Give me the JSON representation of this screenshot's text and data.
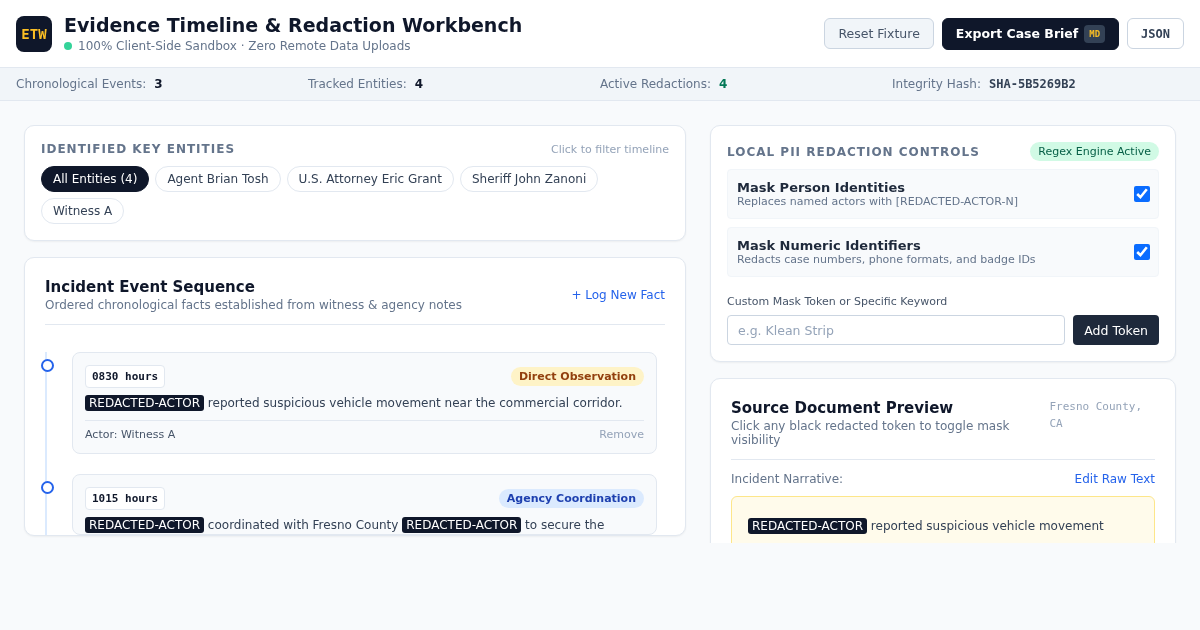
{
  "header": {
    "logo": "ETW",
    "title": "Evidence Timeline & Redaction Workbench",
    "subtitle": "100% Client-Side Sandbox · Zero Remote Data Uploads",
    "buttons": [
      {
        "kind": "secondary",
        "label": "Reset Fixture"
      },
      {
        "kind": "primary",
        "label": "Export Case Brief",
        "badge": "MD"
      },
      {
        "kind": "code",
        "label": "JSON"
      }
    ]
  },
  "stats": [
    {
      "label": "Chronological Events:",
      "value": "3",
      "kind": "count"
    },
    {
      "label": "Tracked Entities:",
      "value": "4",
      "kind": "count"
    },
    {
      "label": "Active Redactions:",
      "value": "4",
      "kind": "positive"
    },
    {
      "label": "Integrity Hash:",
      "value": "SHA-5B5269B2",
      "kind": "hash"
    }
  ],
  "entities": {
    "title": "IDENTIFIED KEY ENTITIES",
    "hint": "Click to filter timeline",
    "chips": [
      {
        "label": "All Entities (4)",
        "selected": true
      },
      {
        "label": "Agent Brian Tosh",
        "selected": false
      },
      {
        "label": "U.S. Attorney Eric Grant",
        "selected": false
      },
      {
        "label": "Sheriff John Zanoni",
        "selected": false
      },
      {
        "label": "Witness A",
        "selected": false
      }
    ]
  },
  "timeline": {
    "title": "Incident Event Sequence",
    "subtitle": "Ordered chronological facts established from witness & agency notes",
    "action": "+ Log New Fact",
    "events": [
      {
        "time": "0830 hours",
        "category": "Direct Observation",
        "kind": "observation",
        "segments": [
          {
            "kind": "redacted",
            "text": "REDACTED-ACTOR"
          },
          {
            "kind": "plain",
            "text": " reported suspicious vehicle movement near the commercial corridor."
          }
        ],
        "actor": "Actor: Witness A",
        "remove": "Remove"
      },
      {
        "time": "1015 hours",
        "category": "Agency Coordination",
        "kind": "coordination",
        "segments": [
          {
            "kind": "redacted",
            "text": "REDACTED-ACTOR"
          },
          {
            "kind": "plain",
            "text": " coordinated with Fresno County "
          },
          {
            "kind": "redacted",
            "text": "REDACTED-ACTOR"
          },
          {
            "kind": "plain",
            "text": " to secure the"
          }
        ]
      }
    ]
  },
  "redaction": {
    "title": "LOCAL PII REDACTION CONTROLS",
    "badge": "Regex Engine Active",
    "options": [
      {
        "title": "Mask Person Identities",
        "description": "Replaces named actors with [REDACTED-ACTOR-N]",
        "checked": true
      },
      {
        "title": "Mask Numeric Identifiers",
        "description": "Redacts case numbers, phone formats, and badge IDs",
        "checked": true
      }
    ],
    "field_label": "Custom Mask Token or Specific Keyword",
    "placeholder": "e.g. Klean Strip",
    "button": "Add Token"
  },
  "preview": {
    "title": "Source Document Preview",
    "subtitle": "Click any black redacted token to toggle mask visibility",
    "location": "Fresno County, CA",
    "narrative_label": "Incident Narrative:",
    "edit": "Edit Raw Text",
    "segments": [
      {
        "kind": "redacted",
        "text": "REDACTED-ACTOR"
      },
      {
        "kind": "plain",
        "text": " reported suspicious vehicle movement"
      }
    ]
  }
}
